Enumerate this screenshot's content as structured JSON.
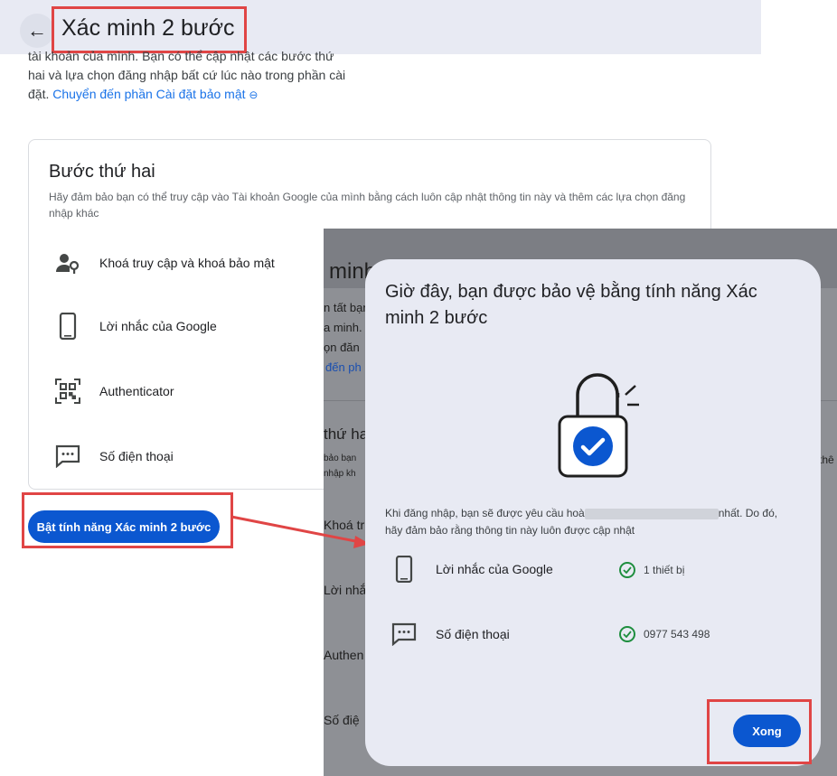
{
  "header": {
    "title": "Xác minh 2 bước",
    "back_icon": "arrow-left-icon"
  },
  "intro": {
    "line1": "tài khoản của mình. Bạn có thể cập nhật các bước thứ",
    "line2": "hai và lựa chọn đăng nhập bất cứ lúc nào trong phần cài",
    "line3_prefix": "đặt.",
    "link": "Chuyển đến phần Cài đặt bảo mật",
    "link_icon": "link-icon"
  },
  "card": {
    "title": "Bước thứ hai",
    "description": "Hãy đảm bảo bạn có thể truy cập vào Tài khoản Google của mình bằng cách luôn cập nhật thông tin này và thêm các lựa chọn đăng nhập khác",
    "methods": [
      {
        "label": "Khoá truy cập và khoá bảo mật",
        "icon": "person-key-icon"
      },
      {
        "label": "Lời nhắc của Google",
        "icon": "phone-icon"
      },
      {
        "label": "Authenticator",
        "icon": "qr-code-icon"
      },
      {
        "label": "Số điện thoại",
        "icon": "message-icon"
      }
    ]
  },
  "enable_button": "Bật tính năng Xác minh 2 bước",
  "background_page": {
    "title_fragment": "minh",
    "texts": [
      "n tất bạn",
      "a minh.",
      "ọn đăn",
      "đến ph",
      "thứ ha",
      "bảo bạn",
      "nhập kh",
      "Khoá tr",
      "Lời nhắ",
      "Authen",
      "Số điệ",
      "thê"
    ]
  },
  "dialog": {
    "title": "Giờ đây, bạn được bảo vệ bằng tính năng Xác minh 2 bước",
    "info_start": "Khi đăng nhập, bạn sẽ được yêu cầu hoà",
    "info_end": "nhất. Do đó,",
    "info_line2": "hãy đảm bảo rằng thông tin này luôn được cập nhật",
    "rows": [
      {
        "label": "Lời nhắc của Google",
        "status": "1 thiết bị",
        "icon": "phone-icon",
        "status_icon": "check-circle-icon"
      },
      {
        "label": "Số điện thoại",
        "status": "0977 543 498",
        "icon": "message-icon",
        "status_icon": "check-circle-icon"
      }
    ],
    "done_button": "Xong",
    "lock_icon": "lock-check-icon"
  },
  "colors": {
    "accent": "#0b57d0",
    "highlight": "#e04545",
    "success": "#1e8e3e"
  }
}
